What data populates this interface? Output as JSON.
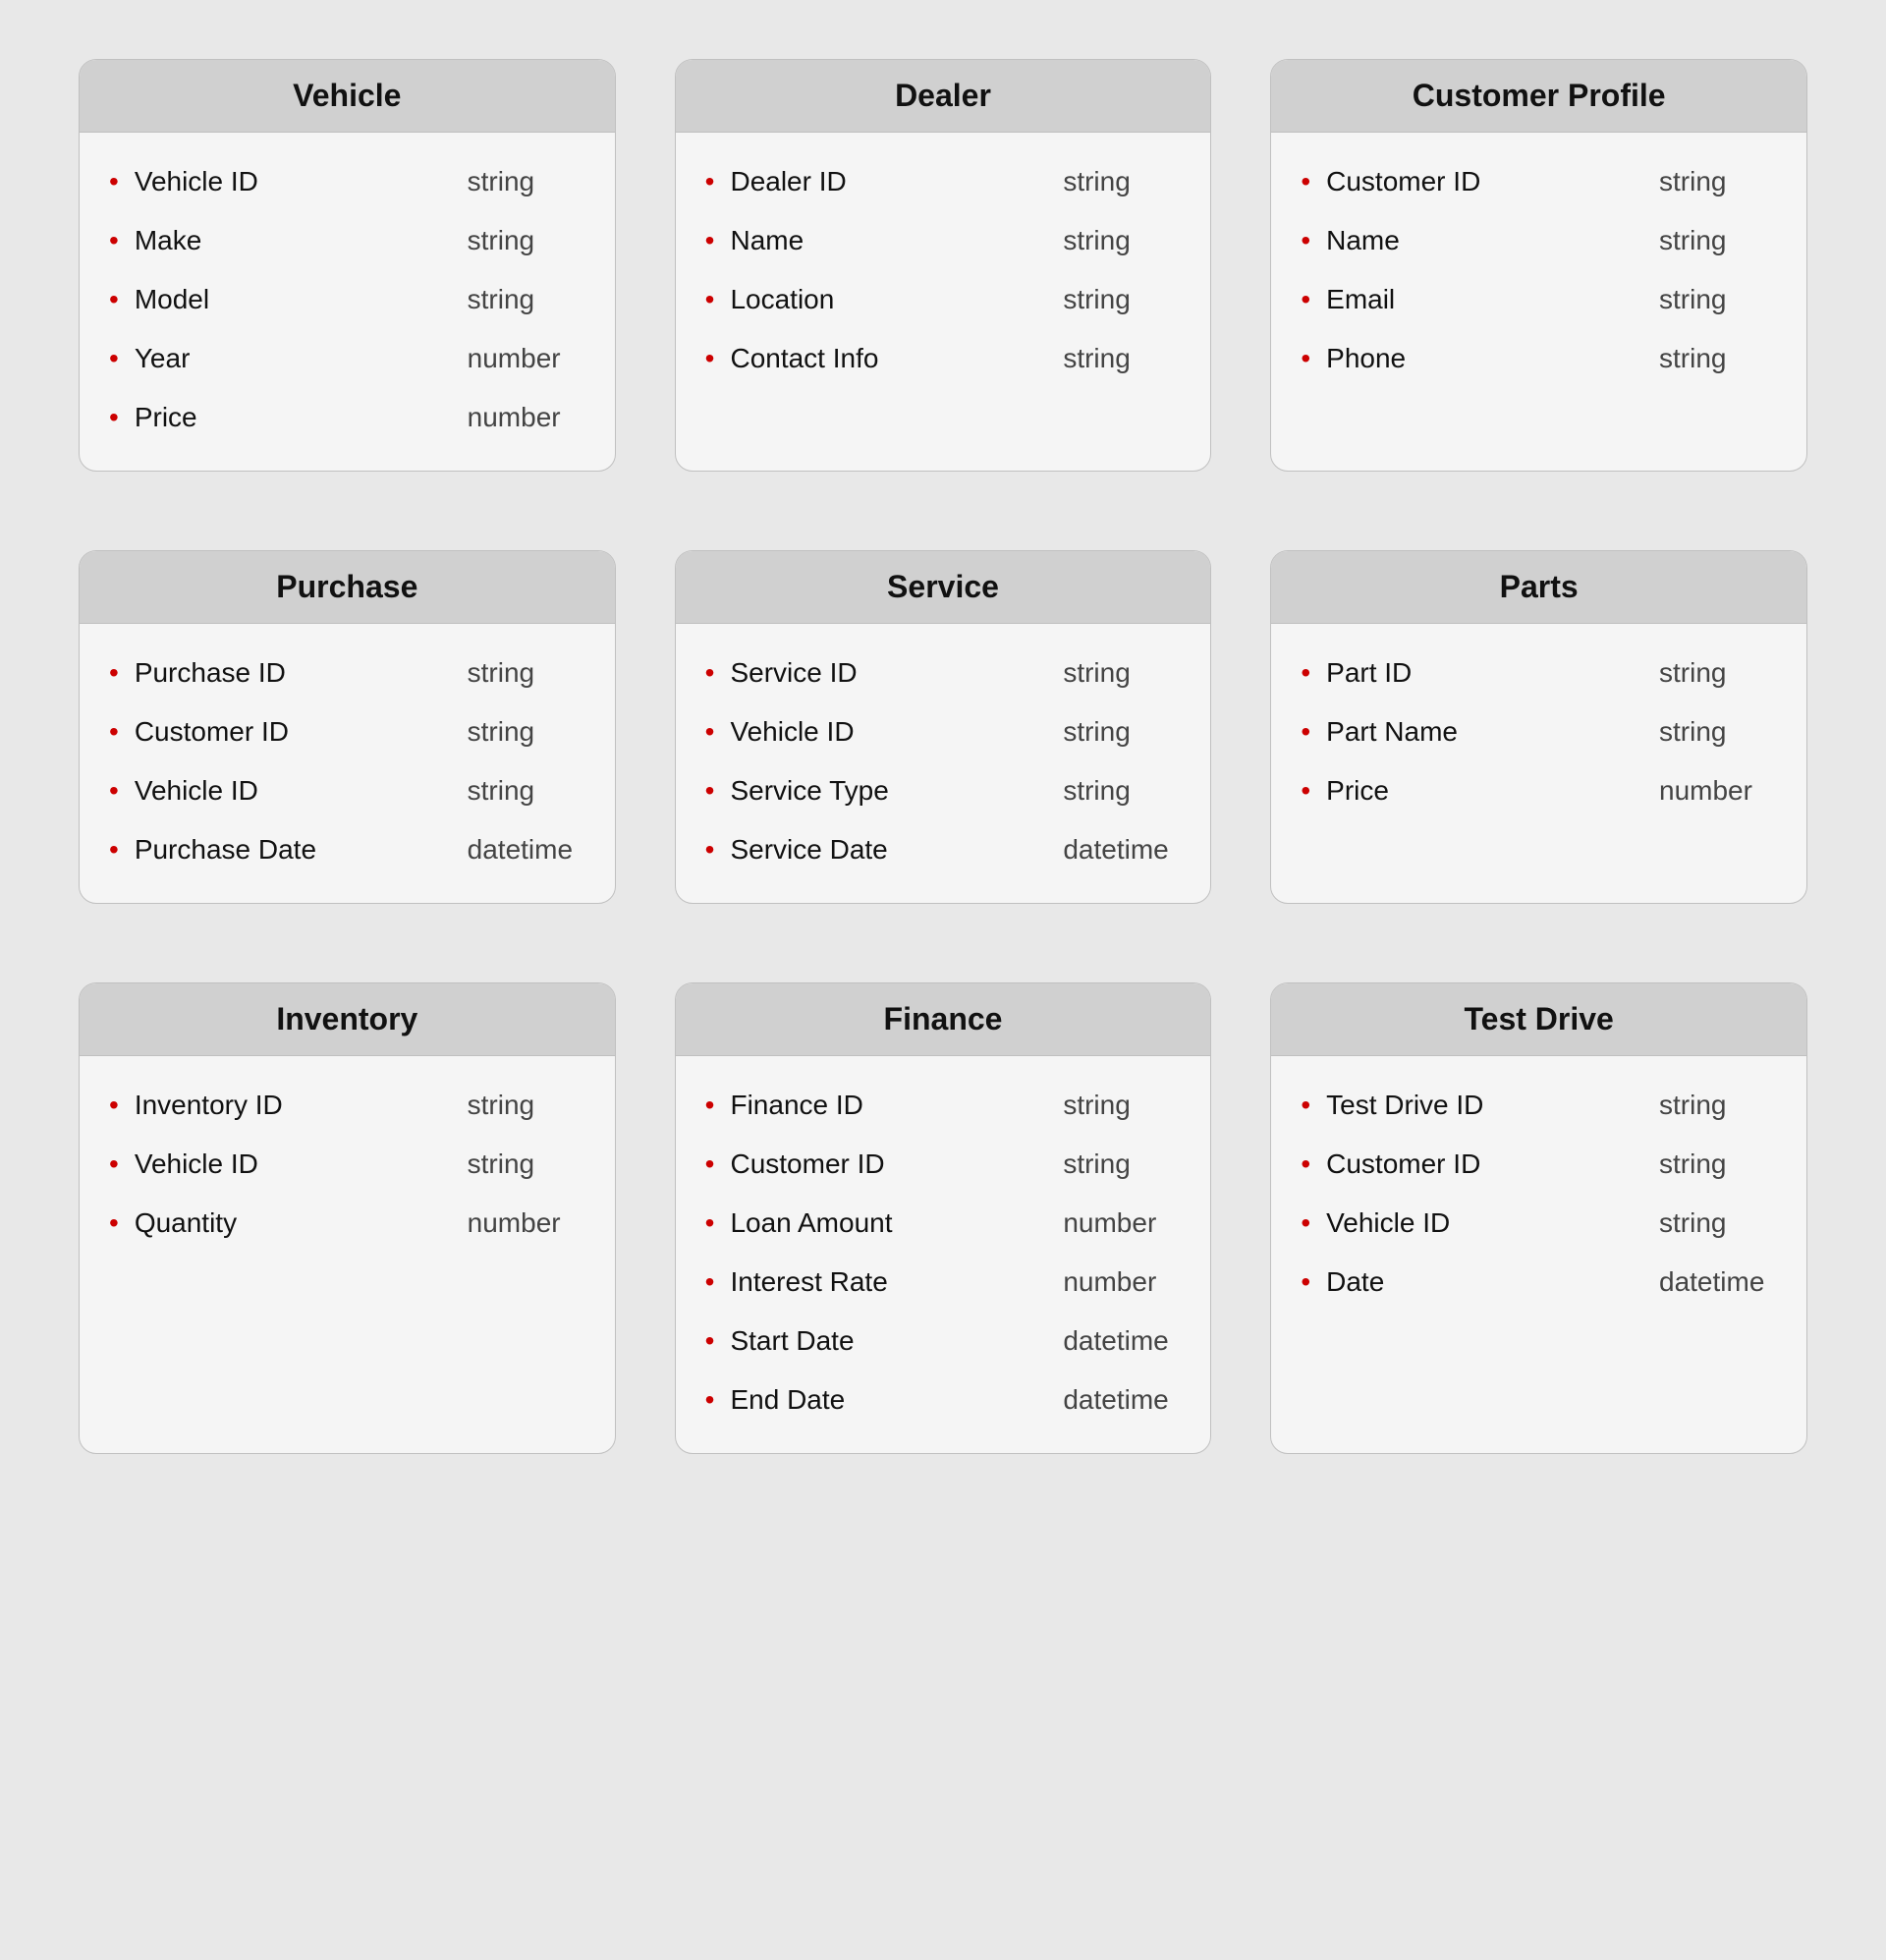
{
  "entities": [
    {
      "id": "vehicle",
      "title": "Vehicle",
      "fields": [
        {
          "name": "Vehicle ID",
          "type": "string"
        },
        {
          "name": "Make",
          "type": "string"
        },
        {
          "name": "Model",
          "type": "string"
        },
        {
          "name": "Year",
          "type": "number"
        },
        {
          "name": "Price",
          "type": "number"
        }
      ]
    },
    {
      "id": "dealer",
      "title": "Dealer",
      "fields": [
        {
          "name": "Dealer ID",
          "type": "string"
        },
        {
          "name": "Name",
          "type": "string"
        },
        {
          "name": "Location",
          "type": "string"
        },
        {
          "name": "Contact Info",
          "type": "string"
        }
      ]
    },
    {
      "id": "customer-profile",
      "title": "Customer Profile",
      "fields": [
        {
          "name": "Customer ID",
          "type": "string"
        },
        {
          "name": "Name",
          "type": "string"
        },
        {
          "name": "Email",
          "type": "string"
        },
        {
          "name": "Phone",
          "type": "string"
        }
      ]
    },
    {
      "id": "purchase",
      "title": "Purchase",
      "fields": [
        {
          "name": "Purchase ID",
          "type": "string"
        },
        {
          "name": "Customer ID",
          "type": "string"
        },
        {
          "name": "Vehicle ID",
          "type": "string"
        },
        {
          "name": "Purchase Date",
          "type": "datetime"
        }
      ]
    },
    {
      "id": "service",
      "title": "Service",
      "fields": [
        {
          "name": "Service ID",
          "type": "string"
        },
        {
          "name": "Vehicle ID",
          "type": "string"
        },
        {
          "name": "Service Type",
          "type": "string"
        },
        {
          "name": "Service Date",
          "type": "datetime"
        }
      ]
    },
    {
      "id": "parts",
      "title": "Parts",
      "fields": [
        {
          "name": "Part ID",
          "type": "string"
        },
        {
          "name": "Part Name",
          "type": "string"
        },
        {
          "name": "Price",
          "type": "number"
        }
      ]
    },
    {
      "id": "inventory",
      "title": "Inventory",
      "fields": [
        {
          "name": "Inventory ID",
          "type": "string"
        },
        {
          "name": "Vehicle ID",
          "type": "string"
        },
        {
          "name": "Quantity",
          "type": "number"
        }
      ]
    },
    {
      "id": "finance",
      "title": "Finance",
      "fields": [
        {
          "name": "Finance ID",
          "type": "string"
        },
        {
          "name": "Customer ID",
          "type": "string"
        },
        {
          "name": "Loan Amount",
          "type": "number"
        },
        {
          "name": "Interest Rate",
          "type": "number"
        },
        {
          "name": "Start Date",
          "type": "datetime"
        },
        {
          "name": "End Date",
          "type": "datetime"
        }
      ]
    },
    {
      "id": "test-drive",
      "title": "Test Drive",
      "fields": [
        {
          "name": "Test Drive ID",
          "type": "string"
        },
        {
          "name": "Customer ID",
          "type": "string"
        },
        {
          "name": "Vehicle ID",
          "type": "string"
        },
        {
          "name": "Date",
          "type": "datetime"
        }
      ]
    }
  ]
}
